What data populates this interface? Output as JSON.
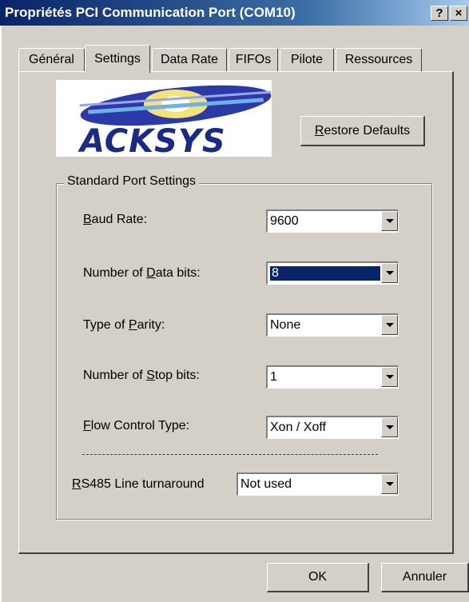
{
  "window": {
    "title": "Propriétés PCI Communication Port (COM10)",
    "help_label": "?",
    "close_label": "×"
  },
  "tabs": [
    {
      "label": "Général",
      "active": false
    },
    {
      "label": "Settings",
      "active": true
    },
    {
      "label": "Data Rate",
      "active": false
    },
    {
      "label": "FIFOs",
      "active": false
    },
    {
      "label": "Pilote",
      "active": false
    },
    {
      "label": "Ressources",
      "active": false
    }
  ],
  "logo": {
    "text": "ACKSYS"
  },
  "restore_button": {
    "mnemonic": "R",
    "rest": "estore Defaults"
  },
  "group": {
    "title": "Standard Port Settings"
  },
  "fields": [
    {
      "label_pre": "",
      "mnemonic": "B",
      "label_post": "aud Rate:",
      "value": "9600",
      "selected": false
    },
    {
      "label_pre": "Number of ",
      "mnemonic": "D",
      "label_post": "ata bits:",
      "value": "8",
      "selected": true
    },
    {
      "label_pre": "Type of ",
      "mnemonic": "P",
      "label_post": "arity:",
      "value": "None",
      "selected": false
    },
    {
      "label_pre": "Number of ",
      "mnemonic": "S",
      "label_post": "top bits:",
      "value": "1",
      "selected": false
    },
    {
      "label_pre": "",
      "mnemonic": "F",
      "label_post": "low Control Type:",
      "value": "Xon / Xoff",
      "selected": false
    },
    {
      "label_pre": "",
      "mnemonic": "R",
      "label_post": "S485 Line turnaround",
      "value": "Not used",
      "selected": false
    }
  ],
  "footer": {
    "ok_label": "OK",
    "cancel_label": "Annuler"
  },
  "colors": {
    "titlebar_start": "#0a246a",
    "face": "#d4d0c8",
    "logo_blue": "#1b2a86",
    "highlight": "#0a246a"
  }
}
